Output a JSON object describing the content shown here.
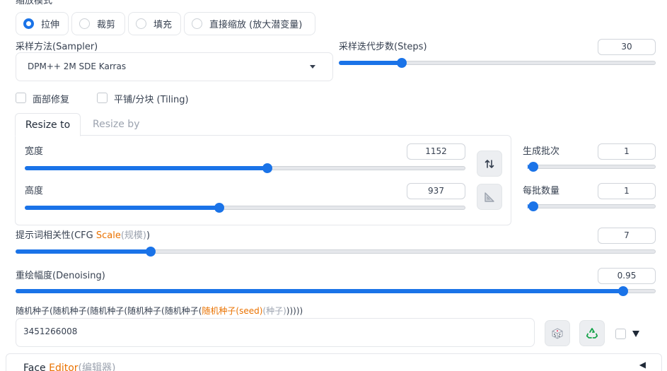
{
  "resize_mode": {
    "section_label": "缩放模式",
    "options": [
      "拉伸",
      "裁剪",
      "填充",
      "直接缩放 (放大潜变量)"
    ],
    "selected": 0
  },
  "sampler": {
    "label": "采样方法(Sampler)",
    "value": "DPM++ 2M SDE Karras"
  },
  "steps": {
    "label": "采样迭代步数(Steps)",
    "value": "30",
    "fraction": 0.197
  },
  "checkboxes": {
    "face_restore": "面部修复",
    "tiling": "平铺/分块 (Tiling)"
  },
  "tabs": {
    "resize_to": "Resize to",
    "resize_by": "Resize by"
  },
  "width": {
    "label": "宽度",
    "value": "1152",
    "fraction": 0.551
  },
  "height": {
    "label": "高度",
    "value": "937",
    "fraction": 0.441
  },
  "batch_count": {
    "label": "生成批次",
    "value": "1",
    "fraction": 0.0
  },
  "batch_size": {
    "label": "每批数量",
    "value": "1",
    "fraction": 0.0
  },
  "cfg": {
    "label_pre": "提示词相关性(CFG ",
    "label_hi": "Scale",
    "label_dim": "(规模)",
    "label_post": ")",
    "value": "7",
    "fraction": 0.21
  },
  "denoise": {
    "label": "重绘幅度(Denoising)",
    "value": "0.95",
    "fraction": 0.95
  },
  "seed": {
    "label_pre": "随机种子(随机种子(随机种子(随机种子(随机种子(",
    "label_hi": "随机种子(seed)",
    "label_dim": "(种子)",
    "label_post": ")))))",
    "value": "3451266008"
  },
  "face_editor": {
    "pre": "Face ",
    "hi": "Editor",
    "dim": "(编辑器)",
    "arrow": "◀"
  },
  "colors": {
    "accent": "#1a73e8",
    "highlight": "#ea7200"
  }
}
